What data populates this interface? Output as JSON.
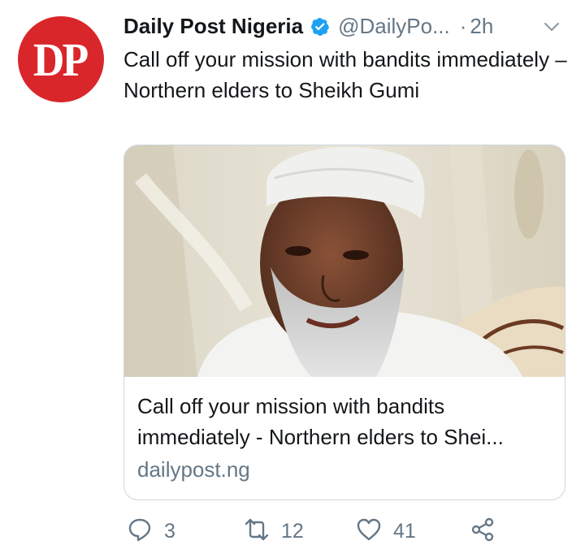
{
  "tweet": {
    "avatar_text": "DP",
    "display_name": "Daily Post Nigeria",
    "handle": "@DailyPo...",
    "separator": "·",
    "time": "2h",
    "text": "Call off your mission with bandits immediately – Northern elders to Sheikh Gumi",
    "colors": {
      "brand_red": "#d9262b",
      "verified_blue": "#1da1f2",
      "muted": "#657786"
    }
  },
  "card": {
    "title_line1": "Call off your mission with bandits",
    "title_line2": "immediately - Northern elders to Shei...",
    "domain": "dailypost.ng",
    "image_description_icon": "photo"
  },
  "actions": {
    "reply_count": "3",
    "retweet_count": "12",
    "like_count": "41",
    "icons": [
      "reply-icon",
      "retweet-icon",
      "like-icon",
      "share-icon"
    ]
  }
}
